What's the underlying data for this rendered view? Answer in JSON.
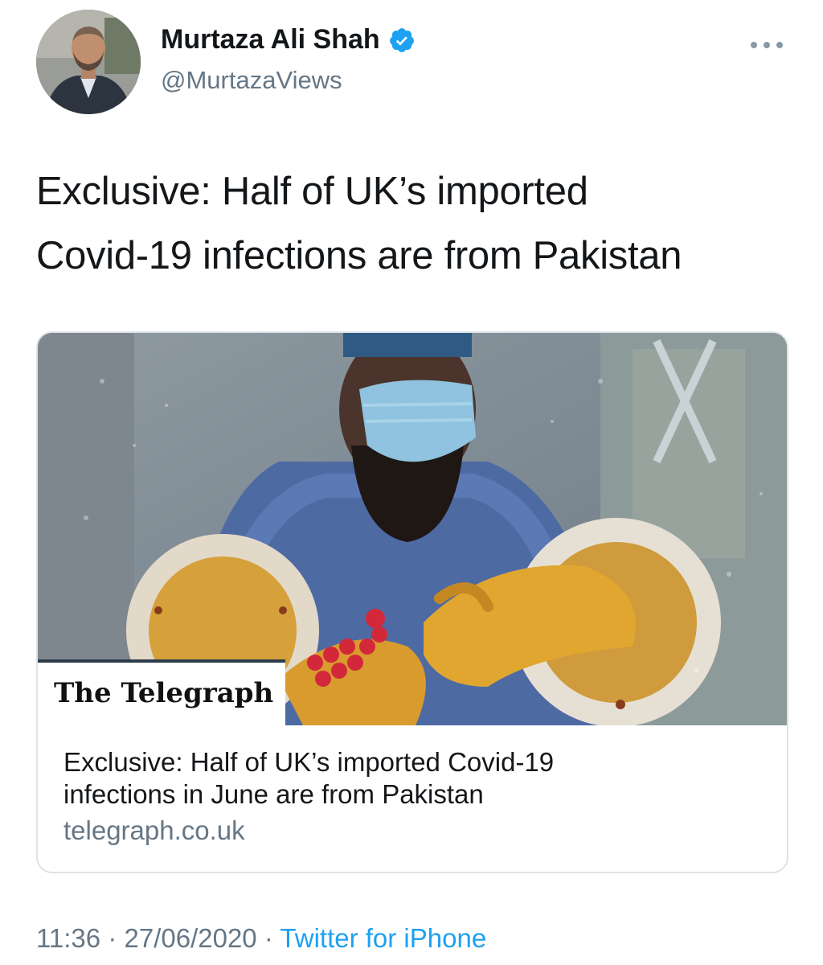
{
  "author": {
    "display_name": "Murtaza Ali Shah",
    "handle": "@MurtazaViews",
    "verified": true,
    "verified_color": "#1da1f2"
  },
  "tweet": {
    "text_line1": "Exclusive: Half of UK’s imported",
    "text_line2": "Covid-19 infections are from Pakistan"
  },
  "card": {
    "publisher_logo": "The Telegraph",
    "title_line1": "Exclusive: Half of UK’s imported Covid-19",
    "title_line2": "infections in June are from Pakistan",
    "domain": "telegraph.co.uk"
  },
  "footer": {
    "time": "11:36",
    "separator": "·",
    "date": "27/06/2020",
    "source": "Twitter for iPhone"
  },
  "icons": {
    "verified": "verified-badge-icon",
    "more": "more-options-icon"
  },
  "colors": {
    "text": "#14171a",
    "secondary": "#657786",
    "link": "#1da1f2",
    "border": "#dde3e8"
  }
}
